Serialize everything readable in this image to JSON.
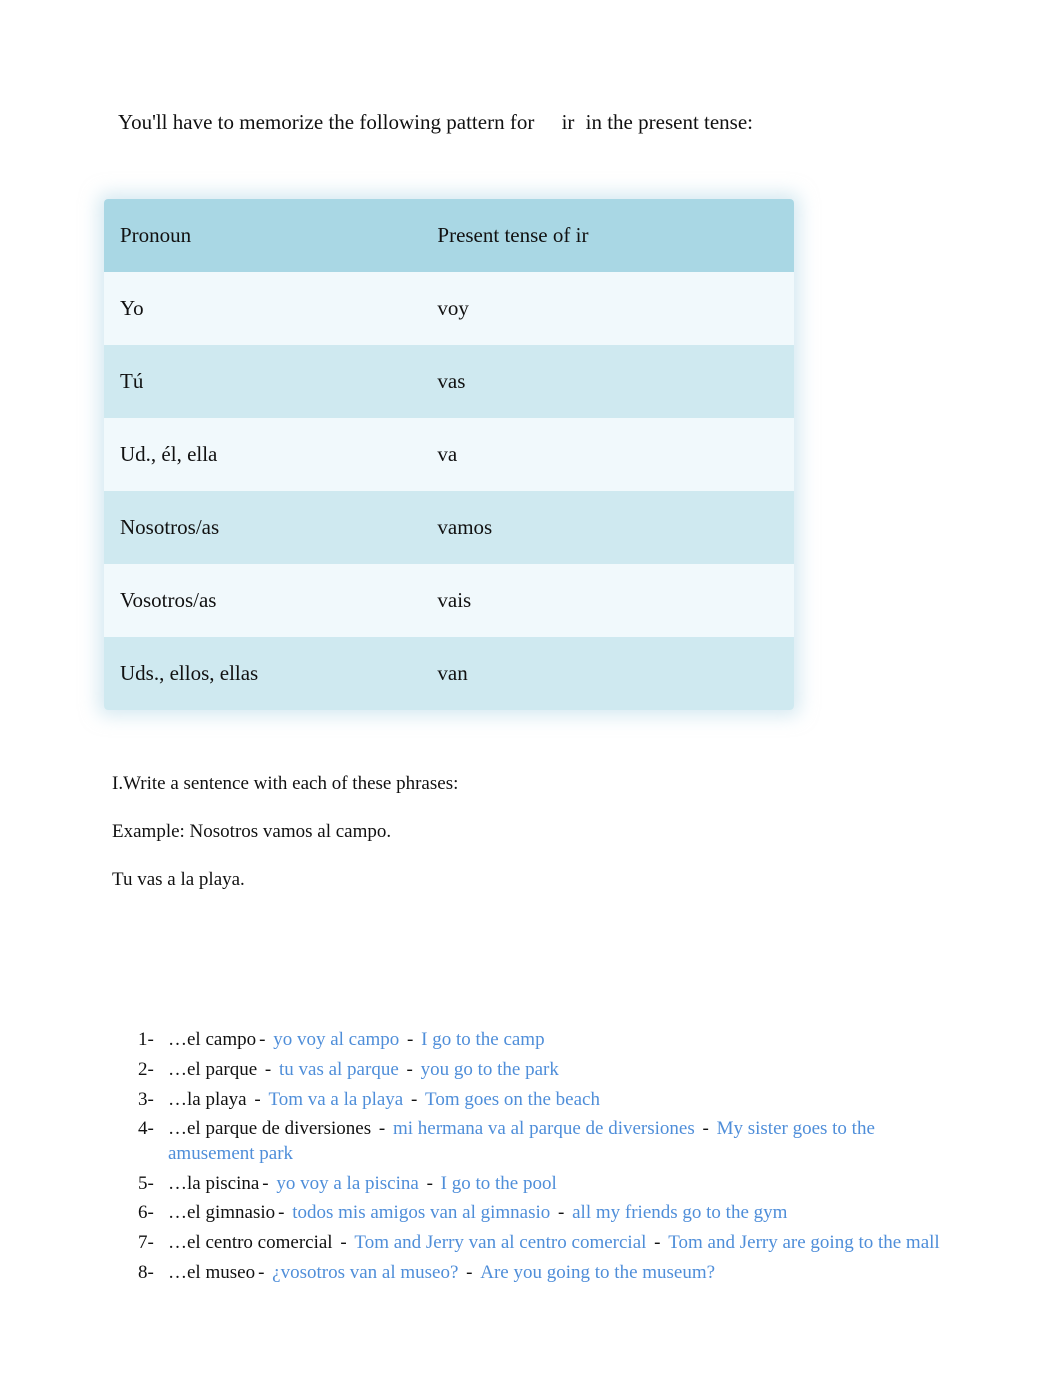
{
  "intro": {
    "before": "You'll have to memorize the following pattern for",
    "verb": "ir",
    "after": "in the present tense:"
  },
  "table": {
    "headers": {
      "col1": "Pronoun",
      "col2": "Present tense of ir"
    },
    "rows": [
      {
        "pronoun": "Yo",
        "form": "voy"
      },
      {
        "pronoun": "Tú",
        "form": "vas"
      },
      {
        "pronoun": "Ud., él, ella",
        "form": "va"
      },
      {
        "pronoun": "Nosotros/as",
        "form": "vamos"
      },
      {
        "pronoun": "Vosotros/as",
        "form": "vais"
      },
      {
        "pronoun": "Uds., ellos, ellas",
        "form": "van"
      }
    ]
  },
  "instructions": {
    "line1": "I.Write a sentence with each of these phrases:",
    "line2": "Example: Nosotros vamos al campo.",
    "line3": "Tu vas a la playa."
  },
  "exercises": [
    {
      "num": "1-",
      "prompt_prefix": "…",
      "prompt": "el campo",
      "answer_es": "yo voy al campo",
      "answer_en": "I go to the camp"
    },
    {
      "num": "2-",
      "prompt_prefix": "…",
      "prompt": "el parque ",
      "answer_es": "tu vas al parque ",
      "answer_en": "you go to the park"
    },
    {
      "num": "3-",
      "prompt_prefix": "…",
      "prompt": "la playa ",
      "answer_es": "Tom va a la playa",
      "answer_en": "Tom goes on the beach"
    },
    {
      "num": "4-",
      "prompt_prefix": "…",
      "prompt": "el parque de diversiones  ",
      "answer_es": "mi hermana va al parque de diversiones  ",
      "answer_en": "My sister goes to the amusement park"
    },
    {
      "num": "5-",
      "prompt_prefix": "…",
      "prompt": "la piscina",
      "answer_es": "yo voy a la piscina",
      "answer_en": "I go to the pool"
    },
    {
      "num": "6-",
      "prompt_prefix": "…",
      "prompt": "el gimnasio",
      "answer_es": "todos mis amigos van al gimnasio",
      "answer_en": "all my friends go to the gym"
    },
    {
      "num": "7-",
      "prompt_prefix": "…",
      "prompt": "el centro comercial ",
      "answer_es": "Tom and Jerry van al centro comercial ",
      "answer_en": "Tom and Jerry are going to the mall"
    },
    {
      "num": "8-",
      "prompt_prefix": "…",
      "prompt": "el museo",
      "answer_es": "¿vosotros van al museo? ",
      "answer_en": "Are you going to the museum?"
    }
  ]
}
